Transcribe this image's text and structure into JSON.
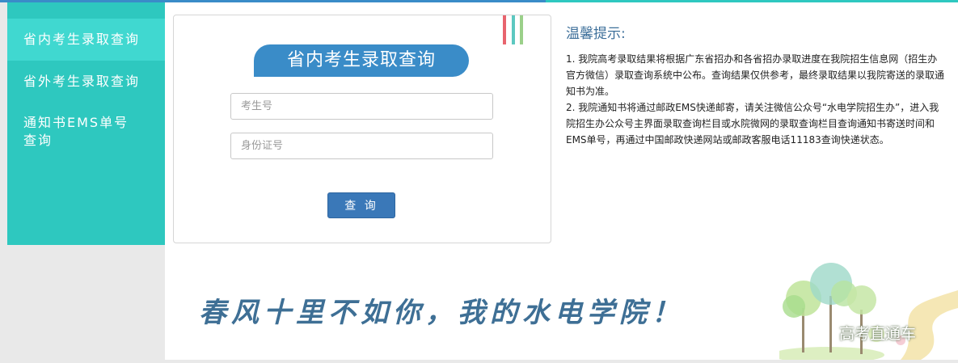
{
  "sidebar": {
    "items": [
      {
        "label": "省内考生录取查询",
        "active": true
      },
      {
        "label": "省外考生录取查询",
        "active": false
      },
      {
        "label": "通知书EMS单号查询",
        "active": false
      }
    ]
  },
  "query_card": {
    "title": "省内考生录取查询",
    "exam_no_placeholder": "考生号",
    "id_placeholder": "身份证号",
    "submit_label": "查 询"
  },
  "tips": {
    "title": "温馨提示:",
    "paragraphs": [
      "1. 我院高考录取结果将根据广东省招办和各省招办录取进度在我院招生信息网（招生办官方微信）录取查询系统中公布。查询结果仅供参考，最终录取结果以我院寄送的录取通知书为准。",
      "2. 我院通知书将通过邮政EMS快递邮寄，请关注微信公众号“水电学院招生办”，进入我院招生办公众号主界面录取查询栏目或水院微网的录取查询栏目查询通知书寄送时间和EMS单号，再通过中国邮政快递网站或邮政客服电话11183查询快递状态。"
    ]
  },
  "banner": {
    "slogan": "春风十里不如你，我的水电学院！",
    "badge": "高考直通车"
  },
  "colors": {
    "sidebar_bg": "#2ec8bf",
    "sidebar_active": "#40d8d0",
    "accent_blue": "#3a8cc8",
    "button_blue": "#3a78b8",
    "stripe_red": "#e8646e",
    "stripe_teal": "#5cc8c0",
    "stripe_green": "#9bd08a"
  }
}
